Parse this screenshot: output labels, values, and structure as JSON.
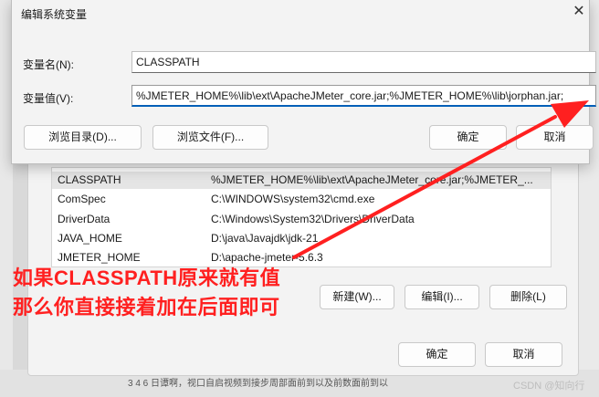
{
  "background": {
    "bottom_text": "3 4 6 日谭啊，视口自启视频到接步周部面前到以及前数面前到以",
    "watermark": "CSDN @知向行"
  },
  "env_dialog": {
    "variables": [
      {
        "name": "CLASSPATH",
        "value": "%JMETER_HOME%\\lib\\ext\\ApacheJMeter_core.jar;%JMETER_..."
      },
      {
        "name": "ComSpec",
        "value": "C:\\WINDOWS\\system32\\cmd.exe"
      },
      {
        "name": "DriverData",
        "value": "C:\\Windows\\System32\\Drivers\\DriverData"
      },
      {
        "name": "JAVA_HOME",
        "value": "D:\\java\\Javajdk\\jdk-21"
      },
      {
        "name": "JMETER_HOME",
        "value": "D:\\apache-jmeter-5.6.3"
      }
    ],
    "new_label": "新建(W)...",
    "edit_label": "编辑(I)...",
    "delete_label": "删除(L)",
    "ok_label": "确定",
    "cancel_label": "取消"
  },
  "edit_dialog": {
    "title": "编辑系统变量",
    "name_label": "变量名(N):",
    "name_value": "CLASSPATH",
    "value_label": "变量值(V):",
    "value_value": "%JMETER_HOME%\\lib\\ext\\ApacheJMeter_core.jar;%JMETER_HOME%\\lib\\jorphan.jar;",
    "browse_dir_label": "浏览目录(D)...",
    "browse_file_label": "浏览文件(F)...",
    "ok_label": "确定",
    "cancel_label": "取消"
  },
  "annotation": {
    "line1": "如果CLASSPATH原来就有值",
    "line2": "那么你直接接着加在后面即可",
    "color": "#ff2020"
  }
}
